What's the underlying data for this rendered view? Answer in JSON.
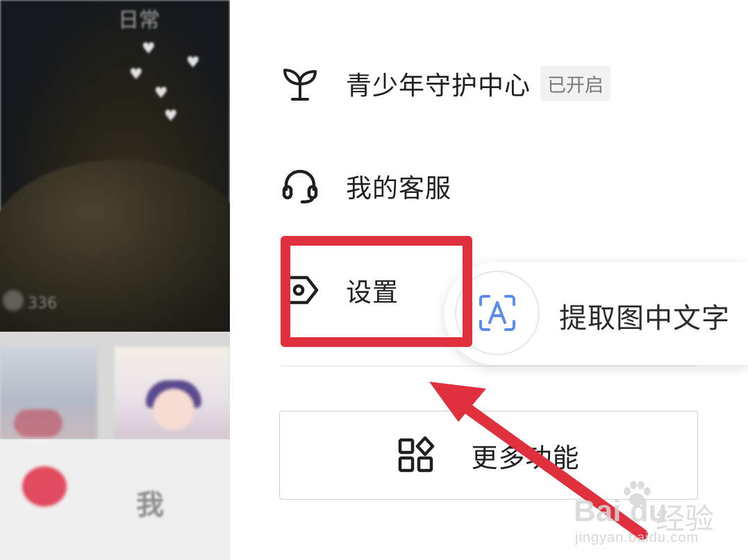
{
  "background_app": {
    "like_count": "336",
    "tab_me_label": "我"
  },
  "drawer": {
    "items": [
      {
        "label": "青少年守护中心",
        "badge": "已开启",
        "icon": "sprout-icon"
      },
      {
        "label": "我的客服",
        "icon": "headset-icon"
      },
      {
        "label": "设置",
        "icon": "settings-tag-icon"
      }
    ],
    "more_button": {
      "label": "更多功能",
      "icon": "grid-apps-icon"
    }
  },
  "ocr_popup": {
    "label": "提取图中文字",
    "icon": "text-scan-icon"
  },
  "annotation": {
    "highlight_color": "#e0303d",
    "arrow_color": "#e0303d"
  },
  "watermark": {
    "logo": "Bai du",
    "brand": "经验",
    "url": "jingyan.baidu.com"
  }
}
